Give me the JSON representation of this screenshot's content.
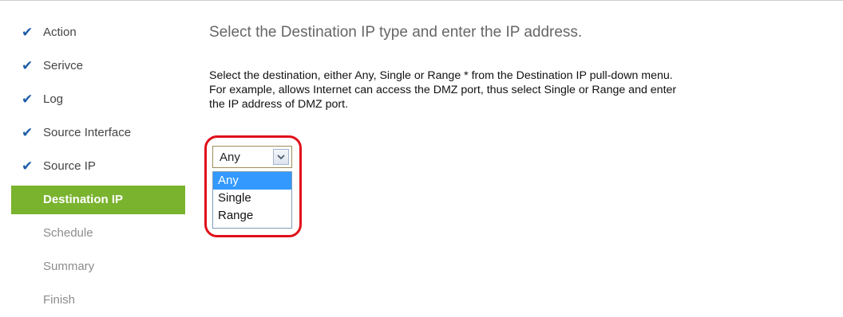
{
  "sidebar": {
    "steps": [
      {
        "label": "Action",
        "status": "done",
        "icon": "check-icon"
      },
      {
        "label": "Serivce",
        "status": "done",
        "icon": "check-icon"
      },
      {
        "label": "Log",
        "status": "done",
        "icon": "check-icon"
      },
      {
        "label": "Source Interface",
        "status": "done",
        "icon": "check-icon"
      },
      {
        "label": "Source IP",
        "status": "done",
        "icon": "check-icon"
      },
      {
        "label": "Destination IP",
        "status": "active"
      },
      {
        "label": "Schedule",
        "status": "pending"
      },
      {
        "label": "Summary",
        "status": "pending"
      },
      {
        "label": "Finish",
        "status": "pending"
      }
    ],
    "check_glyph": "✔",
    "active_color": "#7ab32e",
    "check_color": "#1e5ea8"
  },
  "main": {
    "heading": "Select the Destination IP type and enter the IP address.",
    "description_lines": [
      "Select the destination, either Any, Single or Range * from the Destination IP pull-down menu.",
      "For example, allows Internet can access the DMZ port, thus select Single or Range and enter",
      "the IP address of DMZ port."
    ],
    "destination_ip_select": {
      "value": "Any",
      "options": [
        "Any",
        "Single",
        "Range"
      ],
      "highlighted_option": "Any",
      "annotation_color": "#e0101a"
    }
  }
}
